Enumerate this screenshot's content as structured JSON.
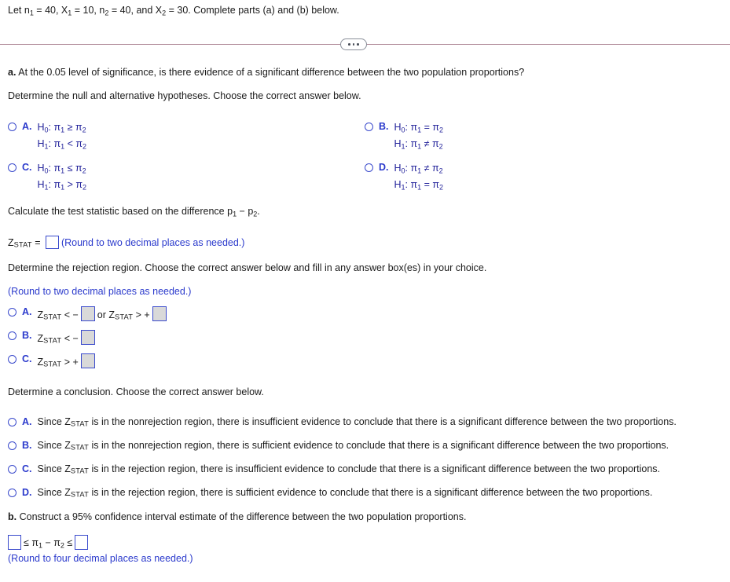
{
  "problem": {
    "stem": "Let n₁ = 40, X₁ = 10, n₂ = 40, and X₂ = 30. Complete parts (a) and (b) below.",
    "stem_parts": {
      "let": "Let n",
      "n1_sub": "1",
      "n1_val": " = 40,  X",
      "x1_sub": "1",
      "x1_val": " = 10,  n",
      "n2_sub": "2",
      "n2_val": " = 40,  and X",
      "x2_sub": "2",
      "x2_val": " = 30.  Complete parts (a) and (b) below."
    }
  },
  "divider": {
    "ellipsis_label": "more-options"
  },
  "part_a": {
    "label": "a.",
    "question": "At the 0.05 level of significance, is there evidence of a significant difference between the two population proportions?",
    "hypotheses_prompt": "Determine the null and alternative hypotheses. Choose the correct answer below.",
    "hypothesis_options": [
      {
        "letter": "A.",
        "null_lhs": "H",
        "null_sub": "0",
        "null_text": ": π",
        "null_s1": "1",
        "null_rel": " ≥ π",
        "null_s2": "2",
        "alt_lhs": "H",
        "alt_sub": "1",
        "alt_text": ": π",
        "alt_s1": "1",
        "alt_rel": " < π",
        "alt_s2": "2"
      },
      {
        "letter": "B.",
        "null_lhs": "H",
        "null_sub": "0",
        "null_text": ": π",
        "null_s1": "1",
        "null_rel": " = π",
        "null_s2": "2",
        "alt_lhs": "H",
        "alt_sub": "1",
        "alt_text": ": π",
        "alt_s1": "1",
        "alt_rel": " ≠ π",
        "alt_s2": "2"
      },
      {
        "letter": "C.",
        "null_lhs": "H",
        "null_sub": "0",
        "null_text": ": π",
        "null_s1": "1",
        "null_rel": " ≤ π",
        "null_s2": "2",
        "alt_lhs": "H",
        "alt_sub": "1",
        "alt_text": ": π",
        "alt_s1": "1",
        "alt_rel": " > π",
        "alt_s2": "2"
      },
      {
        "letter": "D.",
        "null_lhs": "H",
        "null_sub": "0",
        "null_text": ": π",
        "null_s1": "1",
        "null_rel": " ≠ π",
        "null_s2": "2",
        "alt_lhs": "H",
        "alt_sub": "1",
        "alt_text": ": π",
        "alt_s1": "1",
        "alt_rel": " = π",
        "alt_s2": "2"
      }
    ],
    "test_stat_prompt_pre": "Calculate the test statistic based on the difference p",
    "test_stat_prompt_sub1": "1",
    "test_stat_prompt_mid": " − p",
    "test_stat_prompt_sub2": "2",
    "test_stat_prompt_end": ".",
    "zstat_label_z": "Z",
    "zstat_label_sub": "STAT",
    "zstat_equals": " = ",
    "zstat_value": "",
    "zstat_round_note": "(Round to two decimal places as needed.)",
    "rejection_prompt": "Determine the rejection region. Choose the correct answer below and fill in any answer box(es) in your choice.",
    "rejection_round_note": "(Round to two decimal places as needed.)",
    "rejection_options": [
      {
        "letter": "A.",
        "z": "Z",
        "sub": "STAT",
        "rel1": " < −",
        "value1": "",
        "conj": "or",
        "z2": "Z",
        "sub2": "STAT",
        "rel2": " > +",
        "value2": ""
      },
      {
        "letter": "B.",
        "z": "Z",
        "sub": "STAT",
        "rel1": " < −",
        "value1": "",
        "conj": "",
        "z2": "",
        "sub2": "",
        "rel2": "",
        "value2": ""
      },
      {
        "letter": "C.",
        "z": "Z",
        "sub": "STAT",
        "rel1": " > +",
        "value1": "",
        "conj": "",
        "z2": "",
        "sub2": "",
        "rel2": "",
        "value2": ""
      }
    ],
    "conclusion_prompt": "Determine a conclusion. Choose the correct answer below.",
    "conclusion_options": [
      {
        "letter": "A.",
        "pre": "Since Z",
        "sub": "STAT",
        "post": " is in the nonrejection region, there is insufficient evidence to conclude that there is a significant difference between the two proportions."
      },
      {
        "letter": "B.",
        "pre": "Since Z",
        "sub": "STAT",
        "post": " is in the nonrejection region, there is sufficient evidence to conclude that there is a significant difference between the two proportions."
      },
      {
        "letter": "C.",
        "pre": "Since Z",
        "sub": "STAT",
        "post": " is in the rejection region, there is insufficient evidence to conclude that there is a significant difference between the two proportions."
      },
      {
        "letter": "D.",
        "pre": "Since Z",
        "sub": "STAT",
        "post": " is in the rejection region, there is sufficient evidence to conclude that there is a significant difference between the two proportions."
      }
    ]
  },
  "part_b": {
    "label": "b.",
    "question": "Construct a 95% confidence interval estimate of the difference between the two population proportions.",
    "ci_lower_value": "",
    "ci_rel1": "≤ π",
    "ci_sub1": "1",
    "ci_minus": " − π",
    "ci_sub2": "2",
    "ci_rel2": " ≤",
    "ci_upper_value": "",
    "round_note": "(Round to four decimal places as needed.)"
  },
  "colors": {
    "option_blue": "#2b3acc",
    "math_blue": "#23239b",
    "divider_mauve": "#b08a98",
    "box_border": "#3a4acc",
    "box_gray_fill": "#d9d9d9",
    "text_black": "#1a1a1a"
  }
}
